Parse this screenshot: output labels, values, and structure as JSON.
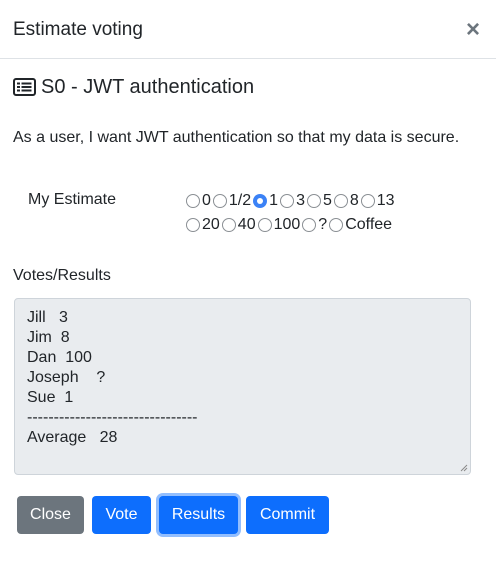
{
  "modal": {
    "title": "Estimate voting",
    "close_glyph": "×"
  },
  "story": {
    "icon": "list-card-icon",
    "title": "S0 - JWT authentication",
    "description": "As a user, I want JWT authentication so that my data is secure."
  },
  "estimate": {
    "label": "My Estimate",
    "selected": "1",
    "options": [
      "0",
      "1/2",
      "1",
      "3",
      "5",
      "8",
      "13",
      "20",
      "40",
      "100",
      "?",
      "Coffee"
    ]
  },
  "votes": {
    "label": "Votes/Results",
    "lines": [
      "Jill   3",
      "Jim  8",
      "Dan  100",
      "Joseph    ?",
      "Sue  1",
      "--------------------------------",
      "Average   28"
    ]
  },
  "buttons": {
    "close": "Close",
    "vote": "Vote",
    "results": "Results",
    "commit": "Commit"
  },
  "colors": {
    "primary": "#0d6efd",
    "secondary": "#6c757d",
    "textarea_bg": "#e9ecef"
  }
}
